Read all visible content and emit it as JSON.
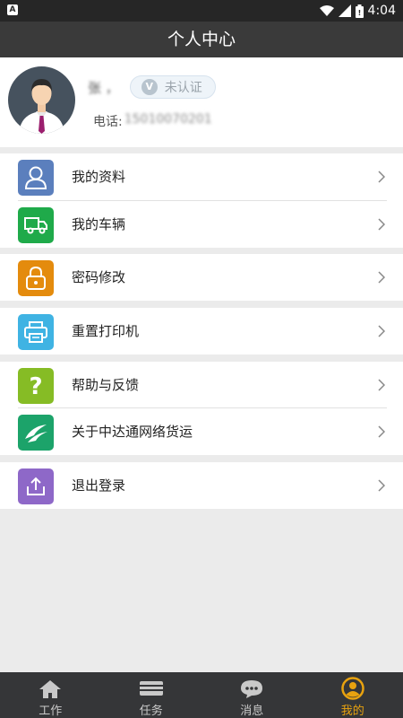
{
  "status_bar": {
    "time": "4:04",
    "left_icon": "a-letter-icon"
  },
  "header": {
    "title": "个人中心"
  },
  "profile": {
    "name": "张 ，",
    "badge": "未认证",
    "badge_icon_letter": "V",
    "phone_label": "电话:",
    "phone_value": "15010070201"
  },
  "menu": {
    "items": [
      {
        "label": "我的资料",
        "icon": "user-icon",
        "color": "#5b7fbd"
      },
      {
        "label": "我的车辆",
        "icon": "truck-icon",
        "color": "#1faa4a"
      },
      {
        "label": "密码修改",
        "icon": "lock-icon",
        "color": "#e48b0d"
      },
      {
        "label": "重置打印机",
        "icon": "printer-icon",
        "color": "#3fb3e3"
      },
      {
        "label": "帮助与反馈",
        "icon": "question-icon",
        "color": "#86bc25"
      },
      {
        "label": "关于中达通网络货运",
        "icon": "logo-icon",
        "color": "#1ca36a"
      },
      {
        "label": "退出登录",
        "icon": "logout-icon",
        "color": "#8e68c8"
      }
    ]
  },
  "tabs": [
    {
      "label": "工作",
      "icon": "home-icon",
      "active": false
    },
    {
      "label": "任务",
      "icon": "wallet-icon",
      "active": false
    },
    {
      "label": "消息",
      "icon": "chat-icon",
      "active": false
    },
    {
      "label": "我的",
      "icon": "person-icon",
      "active": true
    }
  ],
  "colors": {
    "accent": "#e8a20f",
    "titlebar": "#3a3a3a",
    "tabbar": "#353638",
    "background": "#ebebeb"
  }
}
